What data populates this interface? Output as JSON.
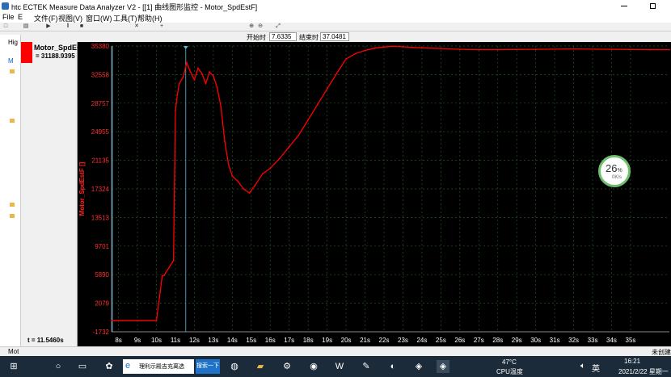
{
  "window": {
    "title": "htc ECTEK Measure Data Analyzer V2 - [[1] 曲线图形监控 - Motor_SpdEstF]",
    "min_icon": "minimize-icon",
    "restore_icon": "restore-icon"
  },
  "menu": [
    "File",
    "E",
    "文件(F)",
    "视图(V)",
    "窗口(W)",
    "工具(T)",
    "帮助(H)"
  ],
  "timebar": {
    "start_label": "开始时",
    "start_value": "7.6335",
    "end_label": "结束时",
    "end_value": "37.0481"
  },
  "tree": {
    "root_label": "Hig",
    "node_label": "M"
  },
  "legend": {
    "signal_name": "Motor_SpdEs",
    "signal_value": "= 31188.9395",
    "color": "#ff0000",
    "cursor_time": "t = 11.5460s"
  },
  "status": {
    "label": "Mot"
  },
  "perf_widget": {
    "percent": "26",
    "unit": "%",
    "rate": "0K/s"
  },
  "taskbar": {
    "search_text": "理利示殿吉充离选",
    "search_button": "搜索一下",
    "temperature": "47°C",
    "temp_label": "CPU温度",
    "ime": "英",
    "time": "16:21",
    "date": "2021/2/22 星期一",
    "notice": "未创建"
  },
  "chart_data": {
    "type": "line",
    "ylabel": "Motor_SpdEstF []",
    "yticks": [
      "35380",
      "32558",
      "28757",
      "24955",
      "21135",
      "17324",
      "13513",
      "9701",
      "5890",
      "2079",
      "-1732"
    ],
    "xticks": [
      "8s",
      "9s",
      "10s",
      "11s",
      "12s",
      "13s",
      "14s",
      "15s",
      "16s",
      "17s",
      "18s",
      "19s",
      "20s",
      "21s",
      "22s",
      "23s",
      "24s",
      "25s",
      "26s",
      "27s",
      "28s",
      "29s",
      "30s",
      "31s",
      "32s",
      "33s",
      "34s",
      "35s"
    ],
    "xlim": [
      7.6335,
      37.0481
    ],
    "ylim": [
      -1732,
      35380
    ],
    "cursor_x": 11.546,
    "series": [
      {
        "color": "#ff0000",
        "x": [
          7.6335,
          8.0,
          9.0,
          10.0,
          10.2,
          10.3,
          10.4,
          10.9,
          11.0,
          11.1,
          11.2,
          11.4,
          11.6,
          11.8,
          12.0,
          12.2,
          12.4,
          12.6,
          12.8,
          13.0,
          13.2,
          13.4,
          13.6,
          13.8,
          14.0,
          14.3,
          14.6,
          14.9,
          15.2,
          15.6,
          16.0,
          16.5,
          17.0,
          17.5,
          18.0,
          18.5,
          19.0,
          19.5,
          20.0,
          20.5,
          21.0,
          21.5,
          22.0,
          22.5,
          23.0,
          23.5,
          24.0,
          25.0,
          26.0,
          27.0,
          28.0,
          30.0,
          32.0,
          34.0,
          36.0,
          37.0481
        ],
        "y": [
          -300,
          -300,
          -300,
          -300,
          3500,
          5500,
          5600,
          7500,
          27000,
          29000,
          30500,
          31300,
          33200,
          32000,
          31000,
          32500,
          31800,
          30500,
          32000,
          31500,
          30000,
          27500,
          23000,
          20000,
          18500,
          17800,
          16800,
          16300,
          17300,
          18800,
          19500,
          20800,
          22300,
          23800,
          25800,
          27800,
          29800,
          31800,
          33700,
          34400,
          34800,
          35100,
          35250,
          35350,
          35280,
          35200,
          35150,
          35050,
          34950,
          34900,
          34900,
          34950,
          35000,
          34950,
          34900,
          34900
        ]
      }
    ]
  }
}
